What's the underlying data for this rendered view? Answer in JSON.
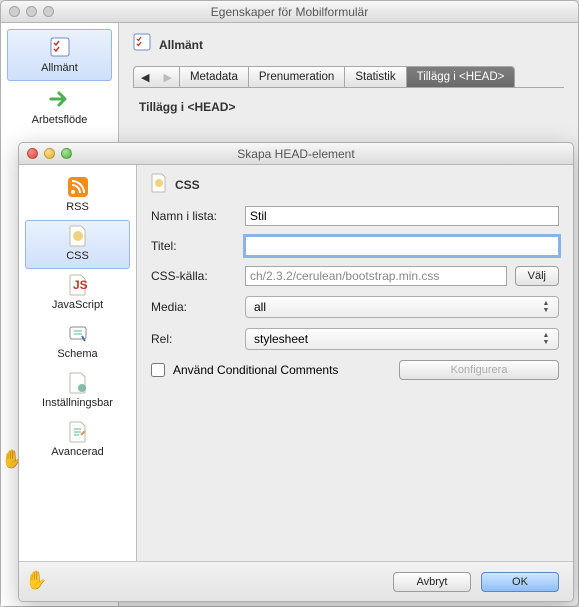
{
  "window1": {
    "title": "Egenskaper för Mobilformulär",
    "sidebar": [
      {
        "label": "Allmänt",
        "icon": "checklist"
      },
      {
        "label": "Arbetsflöde",
        "icon": "arrow"
      }
    ],
    "section_title": "Allmänt",
    "tabs": {
      "metadata": "Metadata",
      "prenum": "Prenumeration",
      "stat": "Statistik",
      "head": "Tillägg i <HEAD>"
    },
    "fieldset": "Tillägg i <HEAD>"
  },
  "window2": {
    "title": "Skapa HEAD-element",
    "sidebar": [
      {
        "label": "RSS"
      },
      {
        "label": "CSS"
      },
      {
        "label": "JavaScript"
      },
      {
        "label": "Schema"
      },
      {
        "label": "Inställningsbar"
      },
      {
        "label": "Avancerad"
      }
    ],
    "panel_title": "CSS",
    "labels": {
      "name": "Namn i lista:",
      "title": "Titel:",
      "source": "CSS-källa:",
      "media": "Media:",
      "rel": "Rel:"
    },
    "values": {
      "name": "Stil",
      "title": "",
      "source": "ch/2.3.2/cerulean/bootstrap.min.css",
      "media": "all",
      "rel": "stylesheet"
    },
    "buttons": {
      "choose": "Välj",
      "configure": "Konfigurera",
      "cancel": "Avbryt",
      "ok": "OK"
    },
    "checkbox": "Använd Conditional Comments"
  }
}
